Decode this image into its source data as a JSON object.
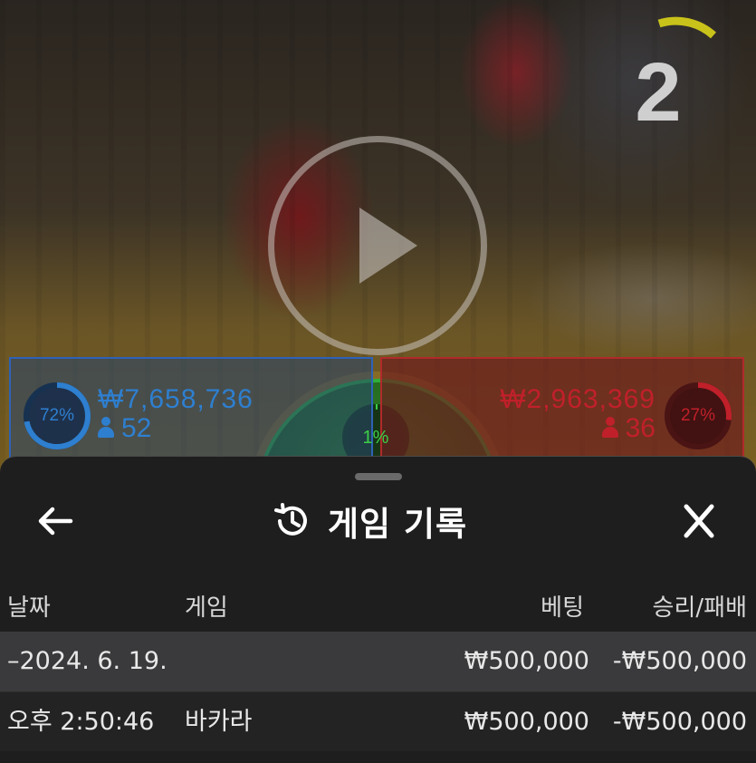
{
  "video": {
    "countdown": "2",
    "countdown_color": "#cfcfcf",
    "timer_arc_color": "#c9c21a"
  },
  "bets": {
    "player": {
      "percent": "72%",
      "percent_value": 0.72,
      "amount": "₩7,658,736",
      "players": "52",
      "color": "#2e7fd0"
    },
    "tie": {
      "percent": "1%",
      "percent_value": 0.01,
      "color": "#3ccf46"
    },
    "banker": {
      "percent": "27%",
      "percent_value": 0.27,
      "amount": "₩2,963,369",
      "players": "36",
      "color": "#c0202a"
    }
  },
  "history": {
    "title": "게임 기록",
    "columns": {
      "date": "날짜",
      "game": "게임",
      "bet": "베팅",
      "result": "승리/패배"
    },
    "rows": [
      {
        "date": "–2024. 6. 19.",
        "game": "",
        "bet": "₩500,000",
        "result": "-₩500,000"
      },
      {
        "date": "오후 2:50:46",
        "game": "바카라",
        "bet": "₩500,000",
        "result": "-₩500,000"
      }
    ]
  }
}
